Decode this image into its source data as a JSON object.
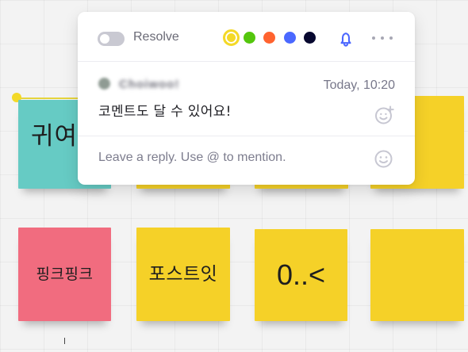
{
  "colors": {
    "board_background": "#f3f3f3",
    "grid": "#e6e6e6",
    "yellow": "#f5d128",
    "pink": "#f16c7f",
    "teal": "#66cbc4",
    "comment_color_yellow": "#f4d928",
    "comment_color_green": "#54c60d",
    "comment_color_orange": "#ff632f",
    "comment_color_blue": "#4a68ff",
    "comment_color_black": "#07082f",
    "bell_blue": "#4b67ff"
  },
  "icons": {
    "toggle": "toggle-icon",
    "bell": "bell-icon",
    "more": "more-icon",
    "reaction": "smiley-plus-icon",
    "emoji": "smiley-icon"
  },
  "board": {
    "sticky_notes": [
      {
        "label": "귀여"
      },
      {
        "label": ""
      },
      {
        "label": ""
      },
      {
        "label": ""
      },
      {
        "label": "핑크핑크"
      },
      {
        "label": "포스트잇"
      },
      {
        "label": "0..<"
      },
      {
        "label": ""
      }
    ]
  },
  "comment": {
    "resolve_label": "Resolve",
    "author": "Choiwoo!",
    "timestamp": "Today, 10:20",
    "text": "코멘트도 달 수 있어요!",
    "reply_placeholder": "Leave a reply. Use @ to mention."
  }
}
